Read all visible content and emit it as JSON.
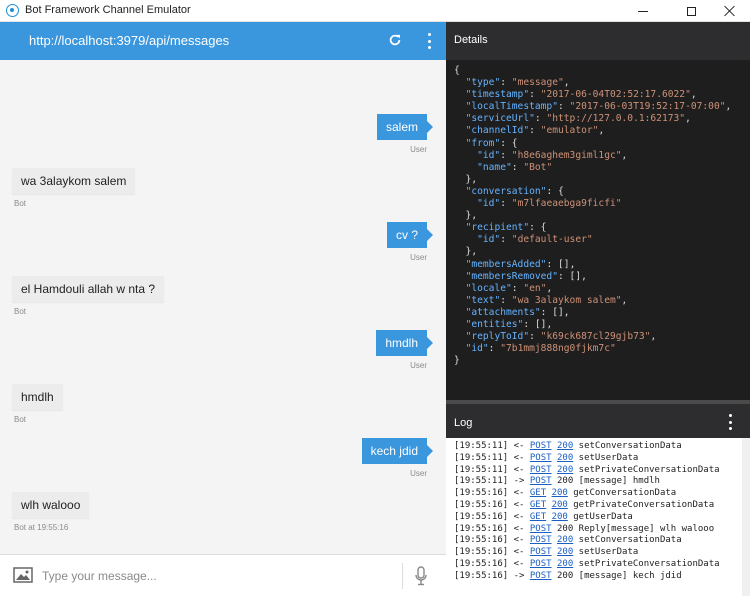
{
  "window": {
    "title": "Bot Framework Channel Emulator"
  },
  "chat": {
    "url": "http://localhost:3979/api/messages",
    "messages": [
      {
        "from": "user",
        "text": "salem",
        "sender_label": "User"
      },
      {
        "from": "bot",
        "text": "wa 3alaykom salem",
        "sender_label": "Bot"
      },
      {
        "from": "user",
        "text": "cv ?",
        "sender_label": "User"
      },
      {
        "from": "bot",
        "text": "el Hamdouli allah w nta ?",
        "sender_label": "Bot"
      },
      {
        "from": "user",
        "text": "hmdlh",
        "sender_label": "User"
      },
      {
        "from": "bot",
        "text": "hmdlh",
        "sender_label": "Bot"
      },
      {
        "from": "user",
        "text": "kech jdid",
        "sender_label": "User"
      },
      {
        "from": "bot",
        "text": "wlh walooo",
        "sender_label": "Bot at 19:55:16"
      }
    ],
    "input": {
      "placeholder": "Type your message..."
    }
  },
  "details": {
    "title": "Details",
    "json": {
      "type": "message",
      "timestamp": "2017-06-04T02:52:17.6022",
      "localTimestamp": "2017-06-03T19:52:17-07:00",
      "serviceUrl": "http://127.0.0.1:62173",
      "channelId": "emulator",
      "from": {
        "id": "h8e6aghem3giml1gc",
        "name": "Bot"
      },
      "conversation": {
        "id": "m7lfaeaebga9ficfi"
      },
      "recipient": {
        "id": "default-user"
      },
      "membersAdded": "[]",
      "membersRemoved": "[]",
      "locale": "en",
      "text": "wa 3alaykom salem",
      "attachments": "[]",
      "entities": "[]",
      "replyToId": "k69ck687cl29gjb73",
      "id": "7b1mmj888ng0fjkm7c"
    }
  },
  "log": {
    "title": "Log",
    "entries": [
      {
        "time": "[19:55:11]",
        "arrow": "<-",
        "method": "POST",
        "status": "200",
        "status_link": true,
        "text": "setConversationData"
      },
      {
        "time": "[19:55:11]",
        "arrow": "<-",
        "method": "POST",
        "status": "200",
        "status_link": true,
        "text": "setUserData"
      },
      {
        "time": "[19:55:11]",
        "arrow": "<-",
        "method": "POST",
        "status": "200",
        "status_link": true,
        "text": "setPrivateConversationData"
      },
      {
        "time": "[19:55:11]",
        "arrow": "->",
        "method": "POST",
        "status": "200",
        "status_link": false,
        "text": "[message] hmdlh"
      },
      {
        "time": "[19:55:16]",
        "arrow": "<-",
        "method": "GET",
        "status": "200",
        "status_link": true,
        "text": "getConversationData"
      },
      {
        "time": "[19:55:16]",
        "arrow": "<-",
        "method": "GET",
        "status": "200",
        "status_link": true,
        "text": "getPrivateConversationData"
      },
      {
        "time": "[19:55:16]",
        "arrow": "<-",
        "method": "GET",
        "status": "200",
        "status_link": true,
        "text": "getUserData"
      },
      {
        "time": "[19:55:16]",
        "arrow": "<-",
        "method": "POST",
        "status": "200",
        "status_link": false,
        "text": "Reply[message] wlh walooo"
      },
      {
        "time": "[19:55:16]",
        "arrow": "<-",
        "method": "POST",
        "status": "200",
        "status_link": true,
        "text": "setConversationData"
      },
      {
        "time": "[19:55:16]",
        "arrow": "<-",
        "method": "POST",
        "status": "200",
        "status_link": true,
        "text": "setUserData"
      },
      {
        "time": "[19:55:16]",
        "arrow": "<-",
        "method": "POST",
        "status": "200",
        "status_link": true,
        "text": "setPrivateConversationData"
      },
      {
        "time": "[19:55:16]",
        "arrow": "->",
        "method": "POST",
        "status": "200",
        "status_link": false,
        "text": "[message] kech jdid"
      }
    ]
  },
  "colors": {
    "accent": "#3a96dd",
    "panel_bg": "#1e1e1e",
    "json_key": "#66b3ff",
    "json_string": "#ce9178",
    "link": "#1a5fc2"
  }
}
